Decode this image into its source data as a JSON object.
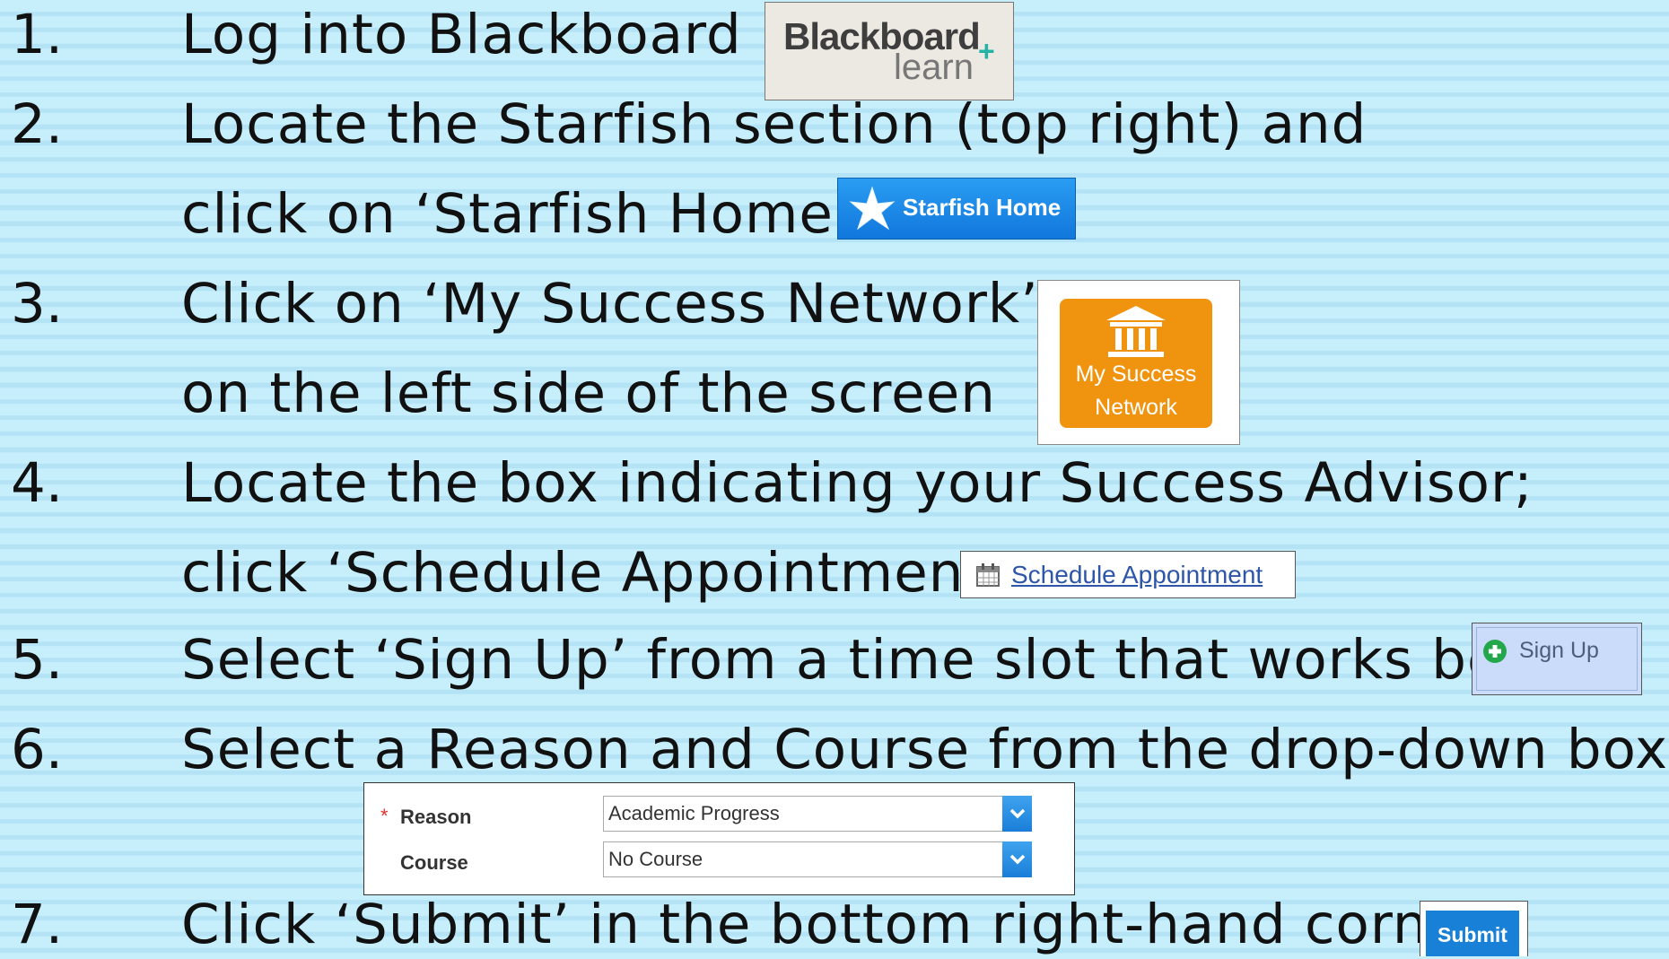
{
  "steps": [
    {
      "number": "1.",
      "lines": [
        "Log into Blackboard"
      ]
    },
    {
      "number": "2.",
      "lines": [
        "Locate the Starfish section (top right) and",
        "click on ‘Starfish Home’"
      ]
    },
    {
      "number": "3.",
      "lines": [
        "Click on ‘My Success Network’",
        "on the left side of the screen"
      ]
    },
    {
      "number": "4.",
      "lines": [
        "Locate the box indicating  your Success Advisor;",
        "click ‘Schedule Appointment’"
      ]
    },
    {
      "number": "5.",
      "lines": [
        "Select ‘Sign Up’ from a time slot that works best"
      ]
    },
    {
      "number": "6.",
      "lines": [
        "Select a Reason and Course from the drop-down boxes."
      ]
    },
    {
      "number": "7.",
      "lines": [
        "Click ‘Submit’ in the bottom right-hand  corner."
      ]
    }
  ],
  "blackboard_logo": {
    "word1": "Blackboard",
    "word2": "learn",
    "plus": "+"
  },
  "starfish_button": {
    "label": "Starfish Home",
    "icon": "starfish-icon"
  },
  "my_success_network": {
    "line1": "My Success",
    "line2": "Network",
    "icon": "institution-icon"
  },
  "schedule_appointment": {
    "label": "Schedule Appointment",
    "icon": "calendar-icon"
  },
  "sign_up": {
    "label": "Sign Up",
    "icon": "plus-circle-icon"
  },
  "form": {
    "required_marker": "*",
    "reason": {
      "label": "Reason",
      "value": "Academic Progress"
    },
    "course": {
      "label": "Course",
      "value": "No Course"
    }
  },
  "submit": {
    "label": "Submit"
  },
  "colors": {
    "starfish_blue": "#1a86e6",
    "orange": "#f0930f",
    "link_blue": "#2e56a8",
    "background": "#c6eefb"
  }
}
